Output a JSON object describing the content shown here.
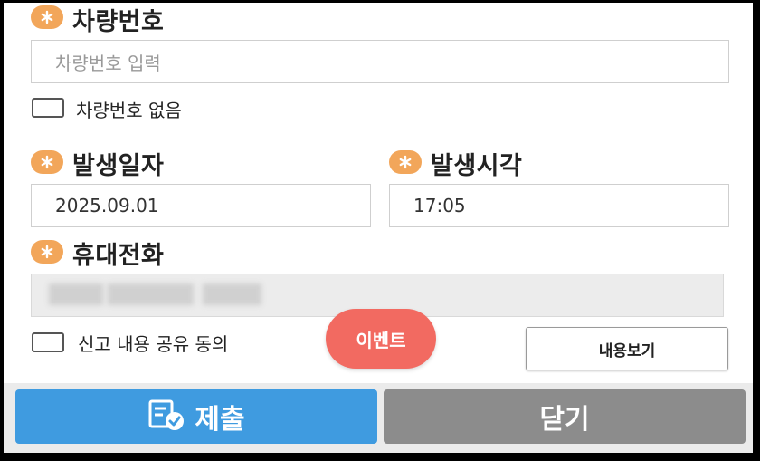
{
  "vehicle_number": {
    "label": "차량번호",
    "placeholder": "차량번호 입력",
    "no_number_checkbox_label": "차량번호 없음"
  },
  "occurrence_date": {
    "label": "발생일자",
    "value": "2025.09.01"
  },
  "occurrence_time": {
    "label": "발생시각",
    "value": "17:05"
  },
  "mobile_phone": {
    "label": "휴대전화",
    "value": ""
  },
  "consent": {
    "checkbox_label": "신고 내용 공유 동의",
    "view_button": "내용보기"
  },
  "event_badge": "이벤트",
  "footer": {
    "submit_label": "제출",
    "close_label": "닫기"
  },
  "colors": {
    "required_marker": "#f2a65a",
    "submit": "#3f9be0",
    "close": "#8c8c8c",
    "event": "#f26a61"
  }
}
